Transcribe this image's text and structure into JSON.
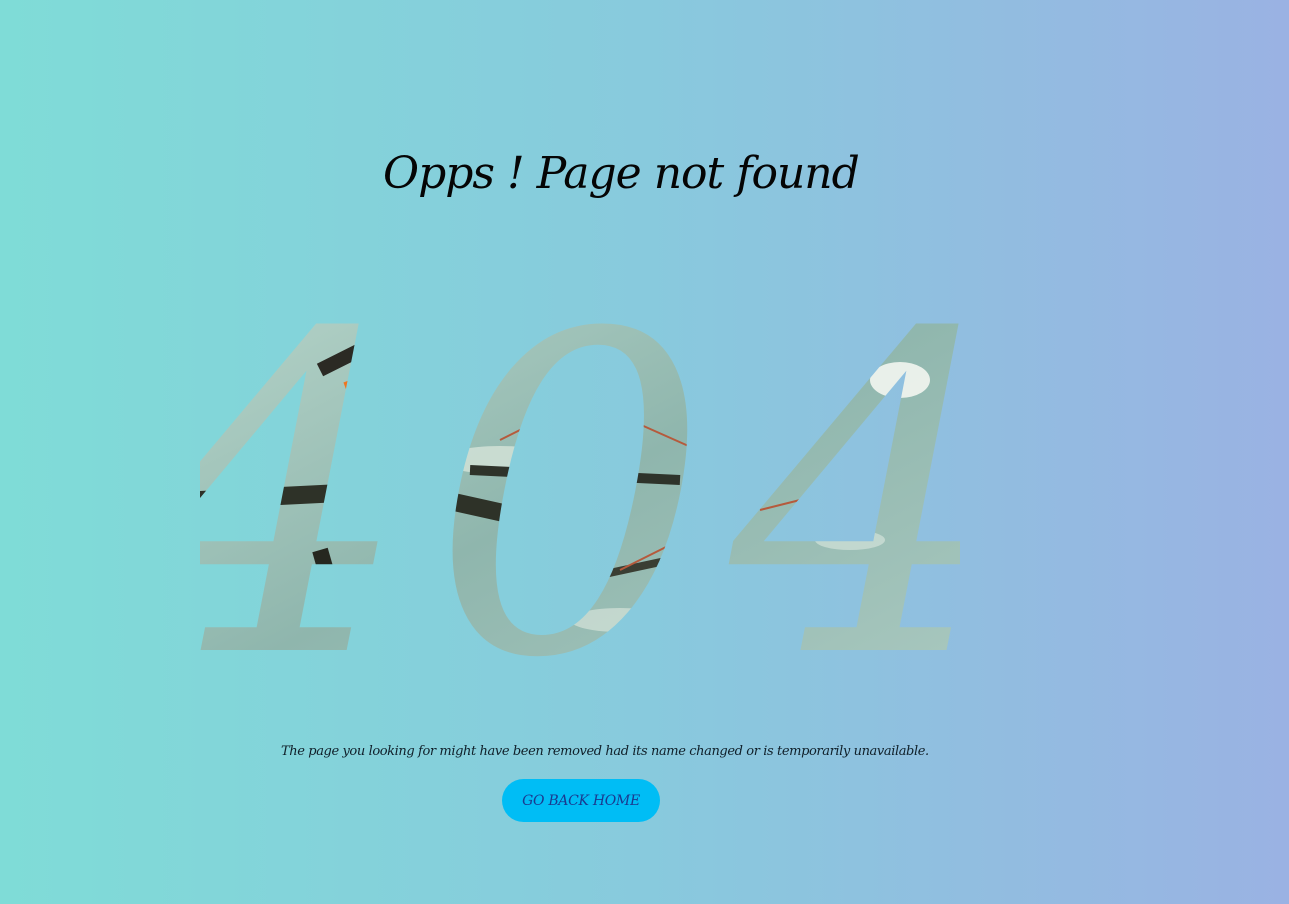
{
  "page": {
    "title": "Opps ! Page not found",
    "code": "404",
    "message": "The page you looking for might have been removed had its name changed or is temporarily unavailable.",
    "home_button_label": "GO BACK HOME"
  },
  "colors": {
    "background_start": "#7fdcd7",
    "background_end": "#9ab2e3",
    "button": "#00bdf5",
    "button_text": "#1a3a8f"
  }
}
